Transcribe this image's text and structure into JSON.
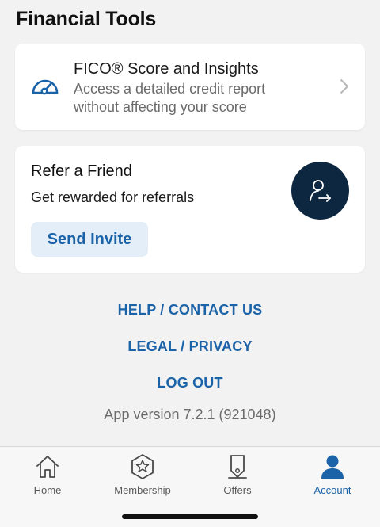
{
  "section_title": "Financial Tools",
  "fico": {
    "title": "FICO® Score and Insights",
    "description_line1": "Access a detailed credit report",
    "description_line2": "without affecting your score",
    "icon": "gauge-icon"
  },
  "refer": {
    "title": "Refer a Friend",
    "subtitle": "Get rewarded for referrals",
    "button_label": "Send Invite",
    "icon": "person-share-icon"
  },
  "links": {
    "help": "HELP / CONTACT US",
    "legal": "LEGAL / PRIVACY",
    "logout": "LOG OUT"
  },
  "version_text": "App version 7.2.1 (921048)",
  "tabbar": {
    "items": [
      {
        "label": "Home",
        "icon": "home-icon"
      },
      {
        "label": "Membership",
        "icon": "membership-star-icon"
      },
      {
        "label": "Offers",
        "icon": "offers-tag-icon"
      },
      {
        "label": "Account",
        "icon": "account-person-icon"
      }
    ],
    "active": "Account"
  },
  "colors": {
    "accent": "#1b63a8",
    "background": "#f2f2f2",
    "avatar_bg": "#0e2740",
    "button_bg": "#e3eef9"
  }
}
